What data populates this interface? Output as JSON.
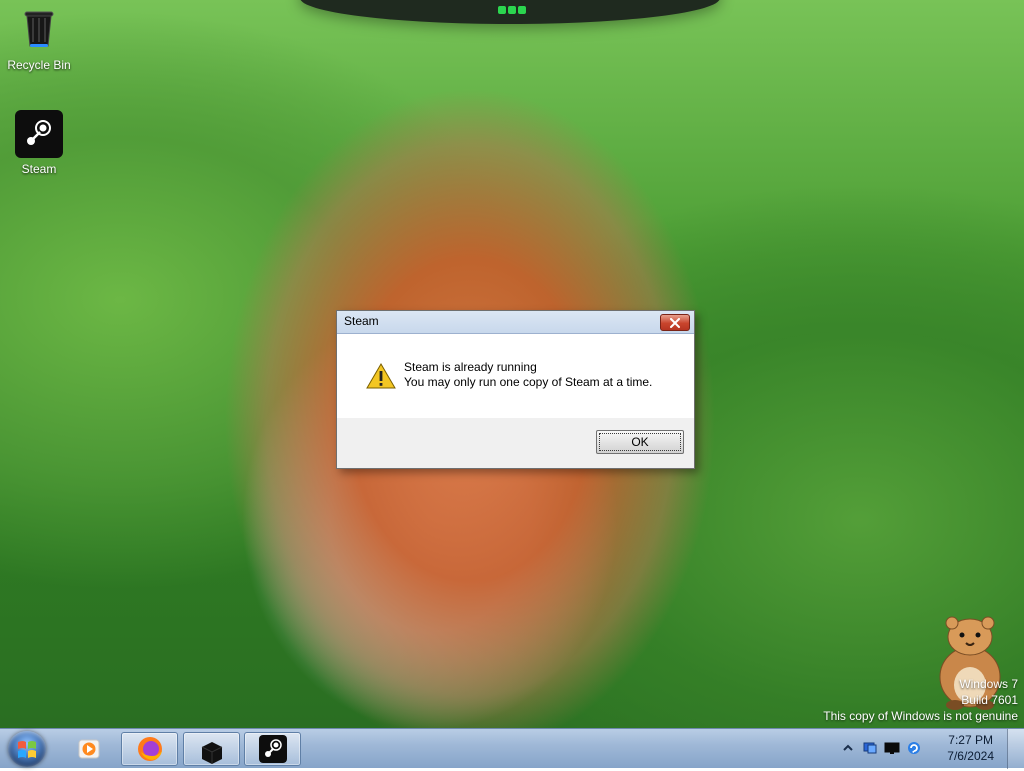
{
  "desktop": {
    "icons": [
      {
        "label": "Recycle Bin"
      },
      {
        "label": "Steam"
      }
    ],
    "watermark": {
      "line1": "Windows 7",
      "line2": "Build 7601",
      "line3": "This copy of Windows is not genuine"
    }
  },
  "dialog": {
    "title": "Steam",
    "message_title": "Steam is already running",
    "message_body": "You may only run one copy of Steam at a time.",
    "ok_label": "OK"
  },
  "taskbar": {
    "pinned": [
      {
        "name": "windows-media-player",
        "active": false
      },
      {
        "name": "firefox",
        "active": true
      },
      {
        "name": "black-box-app",
        "active": true
      },
      {
        "name": "steam",
        "active": true
      }
    ]
  },
  "tray": {
    "time": "7:27 PM",
    "date": "7/6/2024",
    "icons": [
      "chevron-up-icon",
      "network-icon",
      "monitor-icon",
      "ie-refresh-icon"
    ]
  },
  "colors": {
    "accent": "#9fb8d7",
    "dialog_title_bg": "#dbe6f4",
    "close_red": "#c9452d"
  }
}
